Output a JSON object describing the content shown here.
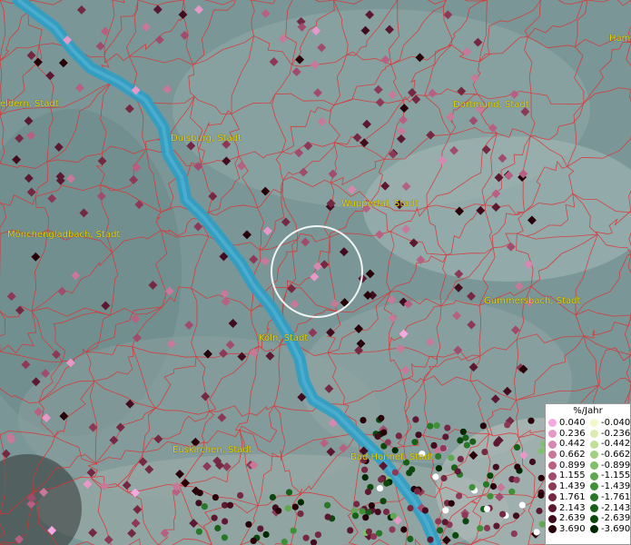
{
  "legend": {
    "title": "%/Jahr",
    "positive": [
      {
        "label": "0.040",
        "color": "#f7a8e0"
      },
      {
        "label": "0.236",
        "color": "#e898c8"
      },
      {
        "label": "0.442",
        "color": "#d888b0"
      },
      {
        "label": "0.662",
        "color": "#c87898"
      },
      {
        "label": "0.899",
        "color": "#b86082"
      },
      {
        "label": "1.155",
        "color": "#a04c6c"
      },
      {
        "label": "1.439",
        "color": "#8c3856"
      },
      {
        "label": "1.761",
        "color": "#742842"
      },
      {
        "label": "2.143",
        "color": "#5c1830"
      },
      {
        "label": "2.639",
        "color": "#420c1e"
      },
      {
        "label": "3.690",
        "color": "#280008"
      }
    ],
    "negative": [
      {
        "label": "-0.040",
        "color": "#f4f8c8"
      },
      {
        "label": "-0.236",
        "color": "#dcecb0"
      },
      {
        "label": "-0.442",
        "color": "#c0e098"
      },
      {
        "label": "-0.662",
        "color": "#a0d080"
      },
      {
        "label": "-0.899",
        "color": "#80c068"
      },
      {
        "label": "-1.155",
        "color": "#60a850"
      },
      {
        "label": "-1.439",
        "color": "#409038"
      },
      {
        "label": "-1.761",
        "color": "#287828"
      },
      {
        "label": "-2.143",
        "color": "#186018"
      },
      {
        "label": "-2.639",
        "color": "#0c480c"
      },
      {
        "label": "-3.690",
        "color": "#002800"
      }
    ]
  },
  "cities": [
    {
      "name": "Ham"
    },
    {
      "name": "eldern, Stadt"
    },
    {
      "name": "Dortmund, Stadt"
    },
    {
      "name": "Duisburg, Stadt"
    },
    {
      "name": "Wuppertal, Stadt"
    },
    {
      "name": "Mönchengladbach, Stadt"
    },
    {
      "name": "Gummersbach, Stadt"
    },
    {
      "name": "Köln, Stadt"
    },
    {
      "name": "Euskirchen, Stadt"
    },
    {
      "name": "Bad Honnef, Stadt"
    }
  ],
  "colors": {
    "river": "#2e9fc4",
    "boundaries": "#e03030",
    "terrain": "#7a9696",
    "selection": "#ffffff"
  }
}
